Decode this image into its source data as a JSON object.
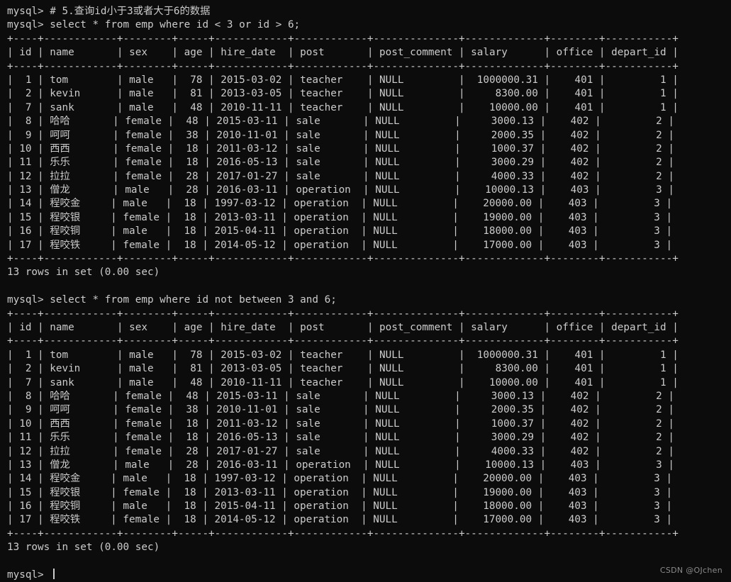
{
  "terminal": {
    "prompt": "mysql>",
    "background_color": "#0c0c0c",
    "text_color": "#cccccc",
    "watermark": "CSDN @OJchen"
  },
  "columns": [
    {
      "name": "id",
      "width": 4,
      "align": "right"
    },
    {
      "name": "name",
      "width": 12,
      "align": "left"
    },
    {
      "name": "sex",
      "width": 8,
      "align": "left"
    },
    {
      "name": "age",
      "width": 5,
      "align": "right"
    },
    {
      "name": "hire_date",
      "width": 12,
      "align": "left"
    },
    {
      "name": "post",
      "width": 12,
      "align": "left"
    },
    {
      "name": "post_comment",
      "width": 14,
      "align": "left"
    },
    {
      "name": "salary",
      "width": 13,
      "align": "right"
    },
    {
      "name": "office",
      "width": 8,
      "align": "right"
    },
    {
      "name": "depart_id",
      "width": 11,
      "align": "right"
    }
  ],
  "rows": [
    {
      "id": "1",
      "name": "tom",
      "sex": "male",
      "age": "78",
      "hire_date": "2015-03-02",
      "post": "teacher",
      "post_comment": "NULL",
      "salary": "1000000.31",
      "office": "401",
      "depart_id": "1"
    },
    {
      "id": "2",
      "name": "kevin",
      "sex": "male",
      "age": "81",
      "hire_date": "2013-03-05",
      "post": "teacher",
      "post_comment": "NULL",
      "salary": "8300.00",
      "office": "401",
      "depart_id": "1"
    },
    {
      "id": "7",
      "name": "sank",
      "sex": "male",
      "age": "48",
      "hire_date": "2010-11-11",
      "post": "teacher",
      "post_comment": "NULL",
      "salary": "10000.00",
      "office": "401",
      "depart_id": "1"
    },
    {
      "id": "8",
      "name": "哈哈",
      "sex": "female",
      "age": "48",
      "hire_date": "2015-03-11",
      "post": "sale",
      "post_comment": "NULL",
      "salary": "3000.13",
      "office": "402",
      "depart_id": "2"
    },
    {
      "id": "9",
      "name": "呵呵",
      "sex": "female",
      "age": "38",
      "hire_date": "2010-11-01",
      "post": "sale",
      "post_comment": "NULL",
      "salary": "2000.35",
      "office": "402",
      "depart_id": "2"
    },
    {
      "id": "10",
      "name": "西西",
      "sex": "female",
      "age": "18",
      "hire_date": "2011-03-12",
      "post": "sale",
      "post_comment": "NULL",
      "salary": "1000.37",
      "office": "402",
      "depart_id": "2"
    },
    {
      "id": "11",
      "name": "乐乐",
      "sex": "female",
      "age": "18",
      "hire_date": "2016-05-13",
      "post": "sale",
      "post_comment": "NULL",
      "salary": "3000.29",
      "office": "402",
      "depart_id": "2"
    },
    {
      "id": "12",
      "name": "拉拉",
      "sex": "female",
      "age": "28",
      "hire_date": "2017-01-27",
      "post": "sale",
      "post_comment": "NULL",
      "salary": "4000.33",
      "office": "402",
      "depart_id": "2"
    },
    {
      "id": "13",
      "name": "僧龙",
      "sex": "male",
      "age": "28",
      "hire_date": "2016-03-11",
      "post": "operation",
      "post_comment": "NULL",
      "salary": "10000.13",
      "office": "403",
      "depart_id": "3"
    },
    {
      "id": "14",
      "name": "程咬金",
      "sex": "male",
      "age": "18",
      "hire_date": "1997-03-12",
      "post": "operation",
      "post_comment": "NULL",
      "salary": "20000.00",
      "office": "403",
      "depart_id": "3"
    },
    {
      "id": "15",
      "name": "程咬银",
      "sex": "female",
      "age": "18",
      "hire_date": "2013-03-11",
      "post": "operation",
      "post_comment": "NULL",
      "salary": "19000.00",
      "office": "403",
      "depart_id": "3"
    },
    {
      "id": "16",
      "name": "程咬铜",
      "sex": "male",
      "age": "18",
      "hire_date": "2015-04-11",
      "post": "operation",
      "post_comment": "NULL",
      "salary": "18000.00",
      "office": "403",
      "depart_id": "3"
    },
    {
      "id": "17",
      "name": "程咬铁",
      "sex": "female",
      "age": "18",
      "hire_date": "2014-05-12",
      "post": "operation",
      "post_comment": "NULL",
      "salary": "17000.00",
      "office": "403",
      "depart_id": "3"
    }
  ],
  "blocks": [
    {
      "type": "comment",
      "command": "# 5.查询id小于3或者大于6的数据"
    },
    {
      "type": "query",
      "command": "select * from emp where id < 3 or id > 6;",
      "result_status": "13 rows in set (0.00 sec)"
    },
    {
      "type": "query",
      "command": "select * from emp where id not between 3 and 6;",
      "result_status": "13 rows in set (0.00 sec)"
    }
  ]
}
